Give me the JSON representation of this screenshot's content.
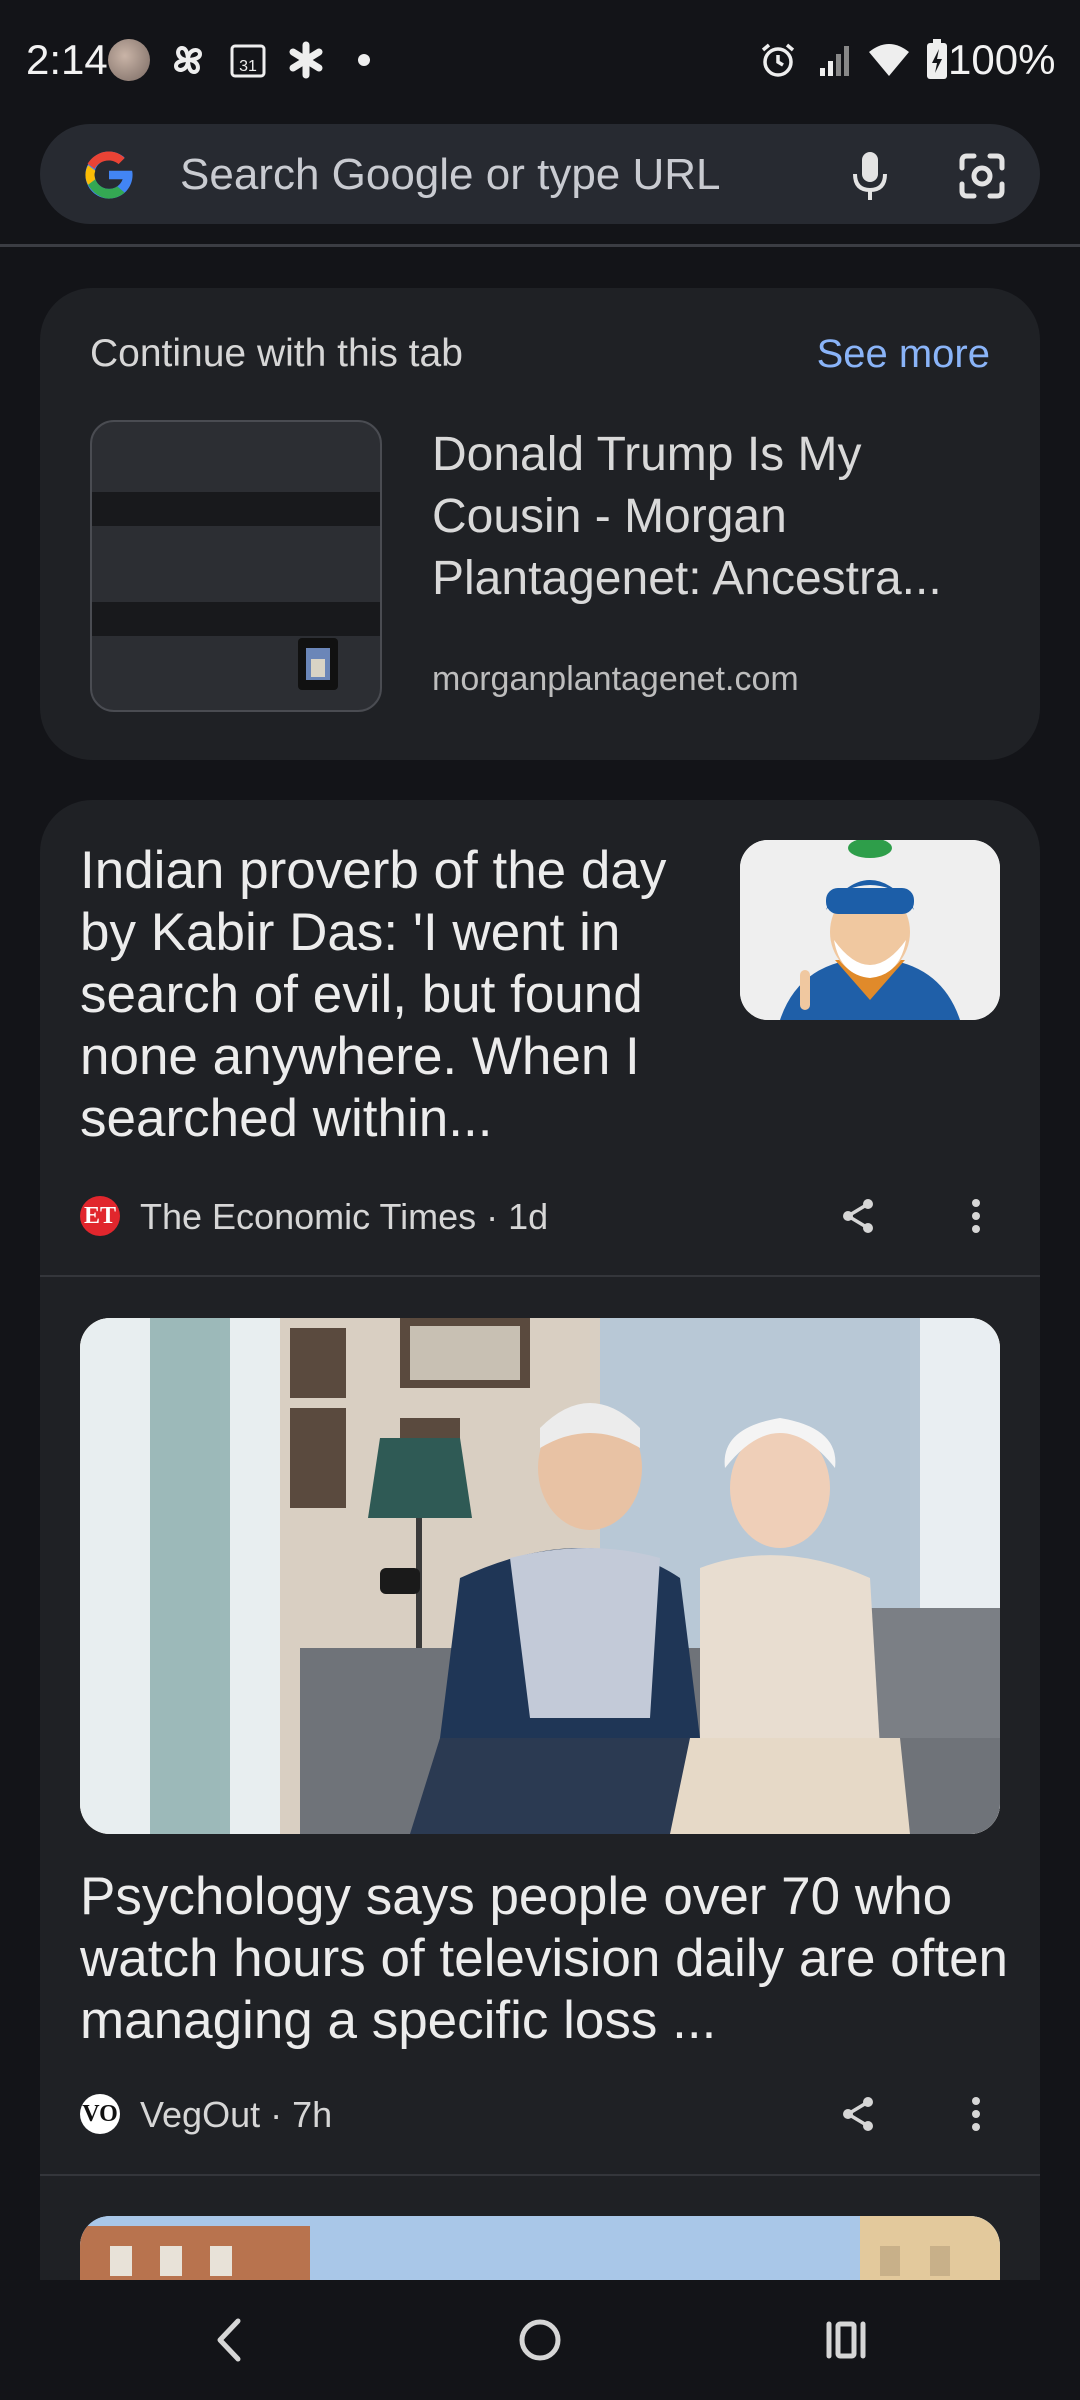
{
  "status_bar": {
    "time": "2:14",
    "battery": "100%",
    "icons": [
      "avatar-icon",
      "pinwheel-icon",
      "calendar-icon",
      "asterisk-icon",
      "dot-icon",
      "alarm-icon",
      "signal-icon",
      "wifi-icon",
      "battery-icon"
    ],
    "calendar_day": "31"
  },
  "search": {
    "placeholder": "Search Google or type URL",
    "icons": [
      "google-logo-icon",
      "mic-icon",
      "lens-icon"
    ]
  },
  "continue_tab": {
    "title": "Continue with this tab",
    "see_more": "See more",
    "page_title": "Donald Trump Is My Cousin - Morgan Plantagenet: Ancestra...",
    "domain": "morganplantagenet.com"
  },
  "feed": {
    "articles": [
      {
        "title": "Indian proverb of the day by Kabir Das: 'I went in search of evil, but found none anywhere. When I searched within...",
        "source": "The Economic Times",
        "age": "1d",
        "source_logo_text": "ET"
      },
      {
        "title": "Psychology says people over 70 who watch hours of television daily are often managing a specific loss ...",
        "source": "VegOut",
        "age": "7h",
        "source_logo_text": "VO"
      }
    ],
    "separator": " · "
  },
  "colors": {
    "background": "#131418",
    "card": "#1f2125",
    "search_bar": "#272a31",
    "link": "#8ab4f8"
  },
  "nav": {
    "icons": [
      "back-icon",
      "home-icon",
      "recents-icon"
    ]
  }
}
